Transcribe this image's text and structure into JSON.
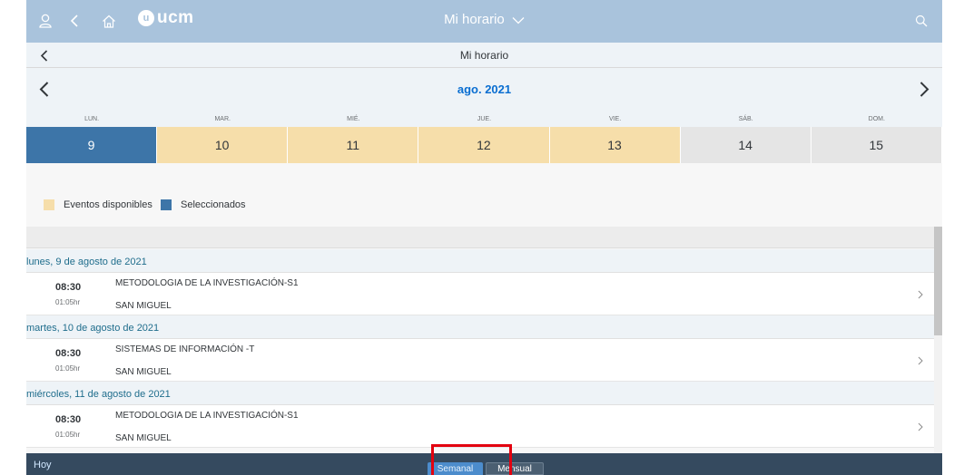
{
  "app": {
    "title": "Mi horario",
    "logo_text": "ucm",
    "logo_seal": "u"
  },
  "subheader": {
    "title": "Mi horario"
  },
  "calendar": {
    "month_label": "ago. 2021",
    "weekdays": [
      "LUN.",
      "MAR.",
      "MIÉ.",
      "JUE.",
      "VIE.",
      "SÁB.",
      "DOM."
    ],
    "days": [
      {
        "num": "9",
        "state": "selected"
      },
      {
        "num": "10",
        "state": "available"
      },
      {
        "num": "11",
        "state": "available"
      },
      {
        "num": "12",
        "state": "available"
      },
      {
        "num": "13",
        "state": "available"
      },
      {
        "num": "14",
        "state": "weekend"
      },
      {
        "num": "15",
        "state": "weekend"
      }
    ]
  },
  "legend": {
    "available_label": "Eventos disponibles",
    "selected_label": "Seleccionados",
    "available_color": "#f6deaa",
    "selected_color": "#3d75a8"
  },
  "events": [
    {
      "date_header": "lunes, 9 de agosto de 2021",
      "time": "08:30",
      "duration": "01:05hr",
      "name": "METODOLOGIA DE LA INVESTIGACIÓN-S1",
      "place": "SAN MIGUEL"
    },
    {
      "date_header": "martes, 10 de agosto de 2021",
      "time": "08:30",
      "duration": "01:05hr",
      "name": "SISTEMAS DE INFORMACIÓN -T",
      "place": "SAN MIGUEL"
    },
    {
      "date_header": "miércoles, 11 de agosto de 2021",
      "time": "08:30",
      "duration": "01:05hr",
      "name": "METODOLOGIA DE LA INVESTIGACIÓN-S1",
      "place": "SAN MIGUEL"
    }
  ],
  "footer": {
    "today_label": "Hoy",
    "weekly_label": "Semanal",
    "monthly_label": "Mensual"
  },
  "icons": {
    "user": "user-icon",
    "back": "back-icon",
    "home": "home-icon",
    "search": "search-icon"
  }
}
